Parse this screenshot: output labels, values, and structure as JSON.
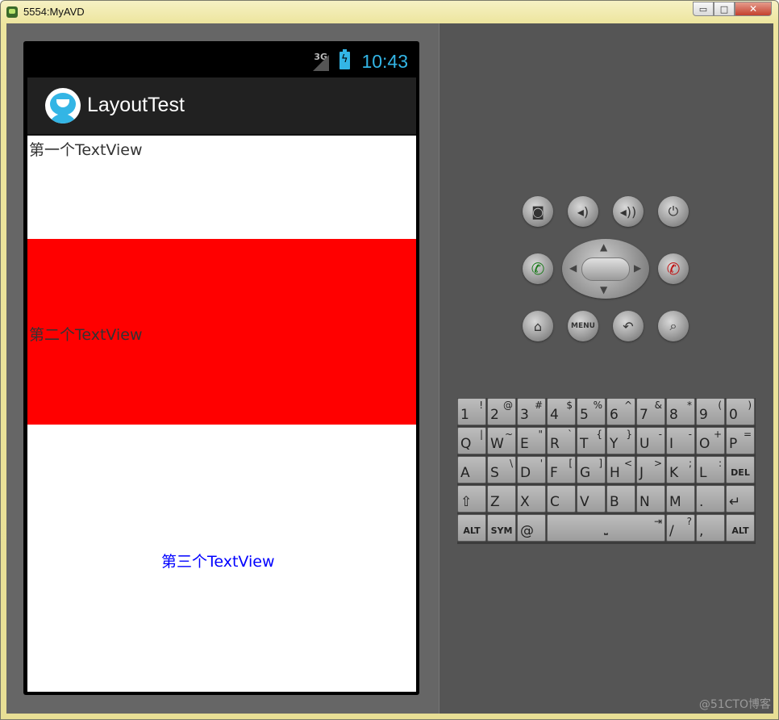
{
  "window": {
    "title": "5554:MyAVD",
    "min": "▭",
    "max": "□",
    "close": "✕"
  },
  "status_bar": {
    "network": "3G",
    "time": "10:43"
  },
  "action_bar": {
    "title": "LayoutTest"
  },
  "content": {
    "first_text": "第一个TextView",
    "second_text": "第二个TextView",
    "third_text": "第三个TextView",
    "second_bg": "#ff0000",
    "third_color": "#0000ff"
  },
  "controls": {
    "menu_label": "MENU"
  },
  "keyboard": {
    "row1": [
      {
        "m": "1",
        "s": "!"
      },
      {
        "m": "2",
        "s": "@"
      },
      {
        "m": "3",
        "s": "#"
      },
      {
        "m": "4",
        "s": "$"
      },
      {
        "m": "5",
        "s": "%"
      },
      {
        "m": "6",
        "s": "^"
      },
      {
        "m": "7",
        "s": "&"
      },
      {
        "m": "8",
        "s": "*"
      },
      {
        "m": "9",
        "s": "("
      },
      {
        "m": "0",
        "s": ")"
      }
    ],
    "row2": [
      {
        "m": "Q",
        "s": "|"
      },
      {
        "m": "W",
        "s": "~"
      },
      {
        "m": "E",
        "s": "\""
      },
      {
        "m": "R",
        "s": "`"
      },
      {
        "m": "T",
        "s": "{"
      },
      {
        "m": "Y",
        "s": "}"
      },
      {
        "m": "U",
        "s": "-"
      },
      {
        "m": "I",
        "s": "-"
      },
      {
        "m": "O",
        "s": "+"
      },
      {
        "m": "P",
        "s": "="
      }
    ],
    "row3": [
      {
        "m": "A",
        "s": ""
      },
      {
        "m": "S",
        "s": "\\"
      },
      {
        "m": "D",
        "s": "'"
      },
      {
        "m": "F",
        "s": "["
      },
      {
        "m": "G",
        "s": "]"
      },
      {
        "m": "H",
        "s": "<"
      },
      {
        "m": "J",
        "s": ">"
      },
      {
        "m": "K",
        "s": ";"
      },
      {
        "m": "L",
        "s": ":"
      },
      {
        "m": "DEL",
        "s": ""
      }
    ],
    "row4": [
      {
        "m": "⇧",
        "s": ""
      },
      {
        "m": "Z",
        "s": ""
      },
      {
        "m": "X",
        "s": ""
      },
      {
        "m": "C",
        "s": ""
      },
      {
        "m": "V",
        "s": ""
      },
      {
        "m": "B",
        "s": ""
      },
      {
        "m": "N",
        "s": ""
      },
      {
        "m": "M",
        "s": ""
      },
      {
        "m": ".",
        "s": ""
      },
      {
        "m": "↵",
        "s": ""
      }
    ],
    "row5": {
      "alt_left": "ALT",
      "sym": "SYM",
      "at": "@",
      "space": "⎵",
      "slash": "/",
      "question": "?",
      "comma": ",",
      "alt_right": "ALT",
      "tab": "⇥"
    }
  },
  "watermark": "@51CTO博客"
}
